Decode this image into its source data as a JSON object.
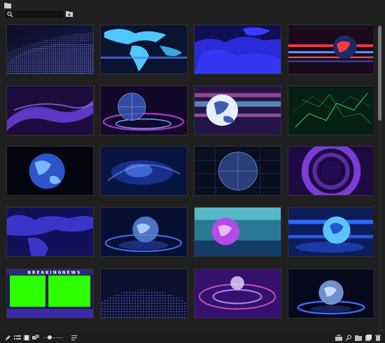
{
  "search": {
    "placeholder": "",
    "value": ""
  },
  "thumbnail_1_overlay_left": "BREAKING",
  "thumbnail_1_overlay_right": "NEWS",
  "colors": {
    "background": "#1f1f1f",
    "accent_green": "#2bff00",
    "accent_blue": "#3a5bff",
    "accent_purple": "#7a2bd9"
  },
  "icons": {
    "top": [
      "folder-icon",
      "search-icon",
      "new-bin-icon"
    ],
    "bottom_left": [
      "pencil-icon",
      "list-view-icon",
      "icon-view-icon",
      "freeform-view-icon",
      "zoom-slider",
      "sort-icon"
    ],
    "bottom_right": [
      "automate-to-sequence-icon",
      "find-icon",
      "new-bin-icon",
      "new-item-icon",
      "clear-icon"
    ]
  },
  "thumbnails": [
    {
      "name": "thumb-dotted-wave-blue"
    },
    {
      "name": "thumb-world-map-cyan"
    },
    {
      "name": "thumb-world-map-dark-blue"
    },
    {
      "name": "thumb-globe-red-lines"
    },
    {
      "name": "thumb-purple-smoke"
    },
    {
      "name": "thumb-wireframe-globe-rings"
    },
    {
      "name": "thumb-globe-light-streaks"
    },
    {
      "name": "thumb-green-network"
    },
    {
      "name": "thumb-blue-globe-dark"
    },
    {
      "name": "thumb-blue-swirl"
    },
    {
      "name": "thumb-grid-globe"
    },
    {
      "name": "thumb-purple-rings"
    },
    {
      "name": "thumb-world-map-purple"
    },
    {
      "name": "thumb-globe-platform"
    },
    {
      "name": "thumb-globe-studio-purple"
    },
    {
      "name": "thumb-globe-studio-blue"
    },
    {
      "name": "thumb-breaking-news-greenscreen"
    },
    {
      "name": "thumb-dotted-dome"
    },
    {
      "name": "thumb-purple-vortex"
    },
    {
      "name": "thumb-globe-pedestal"
    }
  ]
}
